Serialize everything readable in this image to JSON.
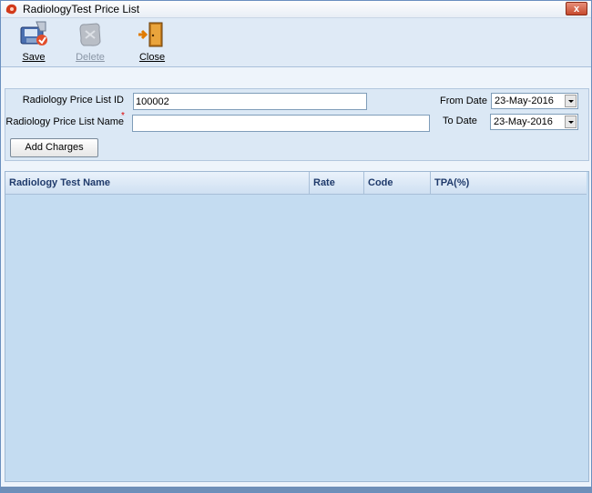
{
  "window": {
    "title": "RadiologyTest Price List",
    "close_glyph": "x"
  },
  "toolbar": {
    "save_label": "Save",
    "delete_label": "Delete",
    "close_label": "Close"
  },
  "form": {
    "price_list_id_label": "Radiology Price List ID",
    "price_list_id_value": "100002",
    "price_list_name_label": "Radiology Price List Name",
    "required_marker": "*",
    "price_list_name_value": "",
    "from_date_label": "From Date",
    "from_date_value": "23-May-2016",
    "to_date_label": "To Date",
    "to_date_value": "23-May-2016",
    "add_charges_label": "Add Charges"
  },
  "grid": {
    "columns": [
      "Radiology Test Name",
      "Rate",
      "Code",
      "TPA(%)"
    ],
    "rows": []
  },
  "colors": {
    "grid_background": "#c4dcf1",
    "header_text": "#1f3a6b"
  }
}
